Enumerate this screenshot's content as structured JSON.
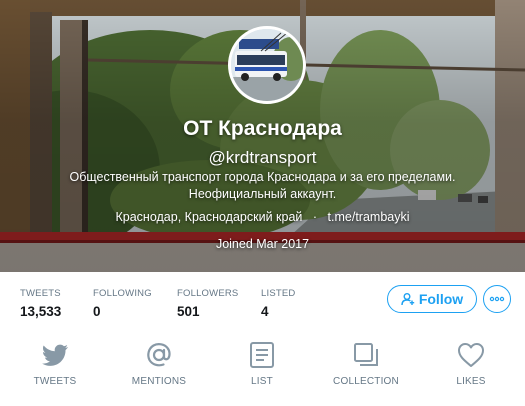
{
  "profile": {
    "name": "ОТ Краснодара",
    "handle": "@krdtransport",
    "bio_line1": "Общественный транспорт города Краснодара и за его пределами.",
    "bio_line2": "Неофициальный аккаунт.",
    "location": "Краснодар, Краснодарский край",
    "separator": "·",
    "website": "t.me/trambayki",
    "joined": "Joined Mar 2017"
  },
  "stats": [
    {
      "label": "TWEETS",
      "value": "13,533"
    },
    {
      "label": "FOLLOWING",
      "value": "0"
    },
    {
      "label": "FOLLOWERS",
      "value": "501"
    },
    {
      "label": "LISTED",
      "value": "4"
    }
  ],
  "actions": {
    "follow_label": "Follow",
    "follow_icon": "add-user-icon",
    "more_icon": "more-icon"
  },
  "tabs": [
    {
      "label": "TWEETS",
      "icon": "bird-icon"
    },
    {
      "label": "MENTIONS",
      "icon": "at-icon"
    },
    {
      "label": "LIST",
      "icon": "list-icon"
    },
    {
      "label": "COLLECTION",
      "icon": "collection-icon"
    },
    {
      "label": "LIKES",
      "icon": "heart-icon"
    }
  ],
  "colors": {
    "accent": "#1da1f2",
    "icon_gray": "#8899a6",
    "label_gray": "#657786",
    "text_dark": "#14171a"
  }
}
